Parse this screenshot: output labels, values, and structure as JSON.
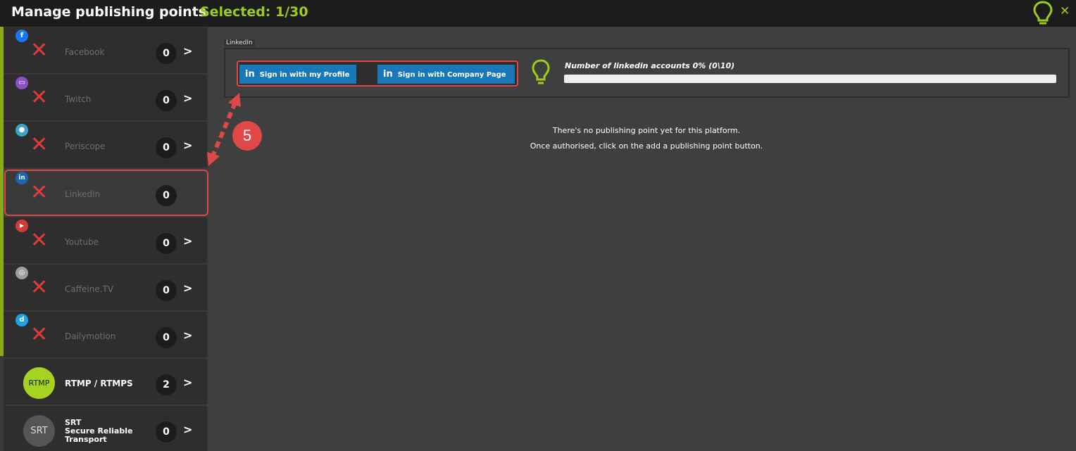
{
  "header": {
    "title": "Manage publishing points",
    "selected": "Selected: 1/30",
    "close_label": "✕"
  },
  "sidebar": {
    "items": [
      {
        "name": "Facebook",
        "count": "0",
        "icon": "facebook-icon",
        "icon_glyph": "f",
        "color": "#1877f2"
      },
      {
        "name": "Twitch",
        "count": "0",
        "icon": "twitch-icon",
        "icon_glyph": "▭",
        "color": "#8a4fc9"
      },
      {
        "name": "Periscope",
        "count": "0",
        "icon": "periscope-icon",
        "icon_glyph": "●",
        "color": "#3aa4c6"
      },
      {
        "name": "LinkedIn",
        "count": "0",
        "icon": "linkedin-icon",
        "icon_glyph": "in",
        "color": "#1a66b2"
      },
      {
        "name": "Youtube",
        "count": "0",
        "icon": "youtube-icon",
        "icon_glyph": "▶",
        "color": "#d33b3b"
      },
      {
        "name": "Caffeine.TV",
        "count": "0",
        "icon": "caffeine-icon",
        "icon_glyph": "◎",
        "color": "#9e9e9e"
      },
      {
        "name": "Dailymotion",
        "count": "0",
        "icon": "dailymotion-icon",
        "icon_glyph": "d",
        "color": "#1aa3e6"
      },
      {
        "name": "RTMP / RTMPS",
        "count": "2",
        "icon": "rtmp-icon",
        "badge": "RTMP",
        "color": "#a4d420"
      },
      {
        "name": "SRT Secure Reliable Transport",
        "name_lines": [
          "SRT",
          "Secure Reliable",
          "Transport"
        ],
        "count": "0",
        "icon": "srt-icon",
        "badge": "SRT",
        "color": "#555555"
      }
    ]
  },
  "main": {
    "section_label": "LinkedIn",
    "buttons": {
      "profile": "Sign in with my Profile",
      "company": "Sign in with Company Page",
      "in_glyph": "in"
    },
    "accounts_text": "Number of linkedin accounts 0% (0\\10)",
    "accounts_percent": 0,
    "empty_line1": "There's no publishing point yet for this platform.",
    "empty_line2": "Once authorised, click on the add a publishing point button."
  },
  "annotation": {
    "step": "5",
    "color": "#e04848"
  },
  "colors": {
    "accent": "#9ccc1c",
    "highlight": "#e04848",
    "linkedin_button": "#1979b8"
  }
}
